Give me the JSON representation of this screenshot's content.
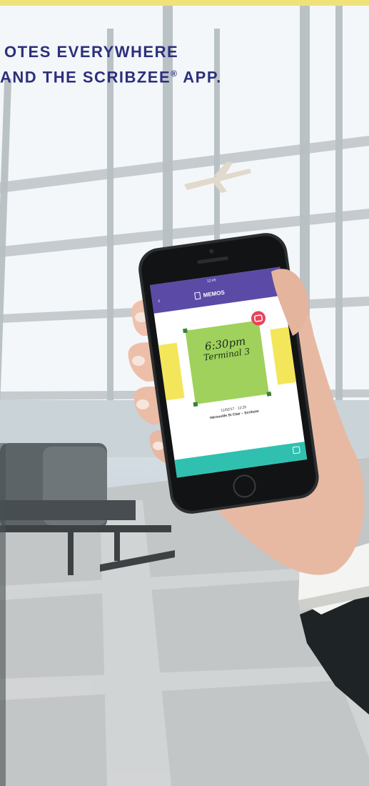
{
  "headline": {
    "line1": "OTES EVERYWHERE",
    "line2_prefix": "AND THE SCRIBZEE",
    "line2_reg": "®",
    "line2_suffix": " APP."
  },
  "app": {
    "title": "MEMOS",
    "status_time": "12:45",
    "note_line1": "6:30pm",
    "note_line2": "Terminal 3",
    "note_date": "11/02/17 · 12:25",
    "note_location": "Hérouville St Clair – Scribzee"
  },
  "colors": {
    "headline": "#2d2f7d",
    "app_bar": "#5b4aa6",
    "note_green": "#9fd15c",
    "note_yellow": "#f3e65a",
    "bottom_bar": "#2fc0b0",
    "badge_red": "#e94359"
  }
}
